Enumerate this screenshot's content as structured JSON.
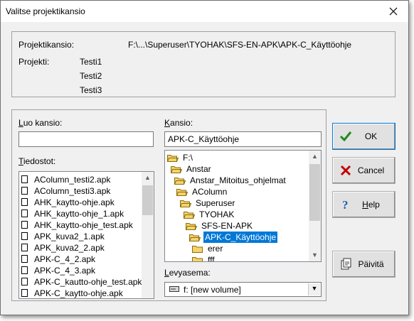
{
  "window": {
    "title": "Valitse projektikansio",
    "close_label": "✕"
  },
  "project_info": {
    "folder_label": "Projektikansio:",
    "folder_path": "F:\\...\\Superuser\\TYOHAK\\SFS-EN-APK\\APK-C_Käyttöohje",
    "project_label": "Projekti:",
    "projects": [
      "Testi1",
      "Testi2",
      "Testi3"
    ]
  },
  "create_folder": {
    "label_prefix": "L",
    "label_rest": "uo kansio:",
    "value": ""
  },
  "files": {
    "label_prefix": "T",
    "label_rest": "iedostot:",
    "items": [
      "AColumn_testi2.apk",
      "AColumn_testi3.apk",
      "AHK_kaytto-ohje.apk",
      "AHK_kaytto-ohje_1.apk",
      "AHK_kaytto-ohje_test.apk",
      "APK_kuva2_1.apk",
      "APK_kuva2_2.apk",
      "APK-C_4_2.apk",
      "APK-C_4_3.apk",
      "APK-C_kautto-ohje_test.apk",
      "APK-C_kaytto-ohje.apk"
    ]
  },
  "folder": {
    "label_prefix": "K",
    "label_rest": "ansio:",
    "value": "APK-C_Käyttöohje",
    "tree": [
      {
        "name": "F:\\",
        "open": true
      },
      {
        "name": "Anstar",
        "open": true
      },
      {
        "name": "Anstar_Mitoitus_ohjelmat",
        "open": true
      },
      {
        "name": "AColumn",
        "open": true
      },
      {
        "name": "Superuser",
        "open": true
      },
      {
        "name": "TYOHAK",
        "open": true
      },
      {
        "name": "SFS-EN-APK",
        "open": true
      },
      {
        "name": "APK-C_Käyttöohje",
        "open": true,
        "selected": true
      },
      {
        "name": "erer",
        "open": false
      },
      {
        "name": "fff",
        "open": false
      }
    ]
  },
  "drive": {
    "label_prefix": "L",
    "label_rest": "evyasema:",
    "value": "f: [new volume]"
  },
  "buttons": {
    "ok": "OK",
    "cancel": "Cancel",
    "help_prefix": "H",
    "help_rest": "elp",
    "refresh": "Päivitä"
  },
  "colors": {
    "selection": "#0078d7",
    "ok_check": "#1e8a1e",
    "cancel_x": "#c00000",
    "help_q": "#1f5fbf"
  }
}
